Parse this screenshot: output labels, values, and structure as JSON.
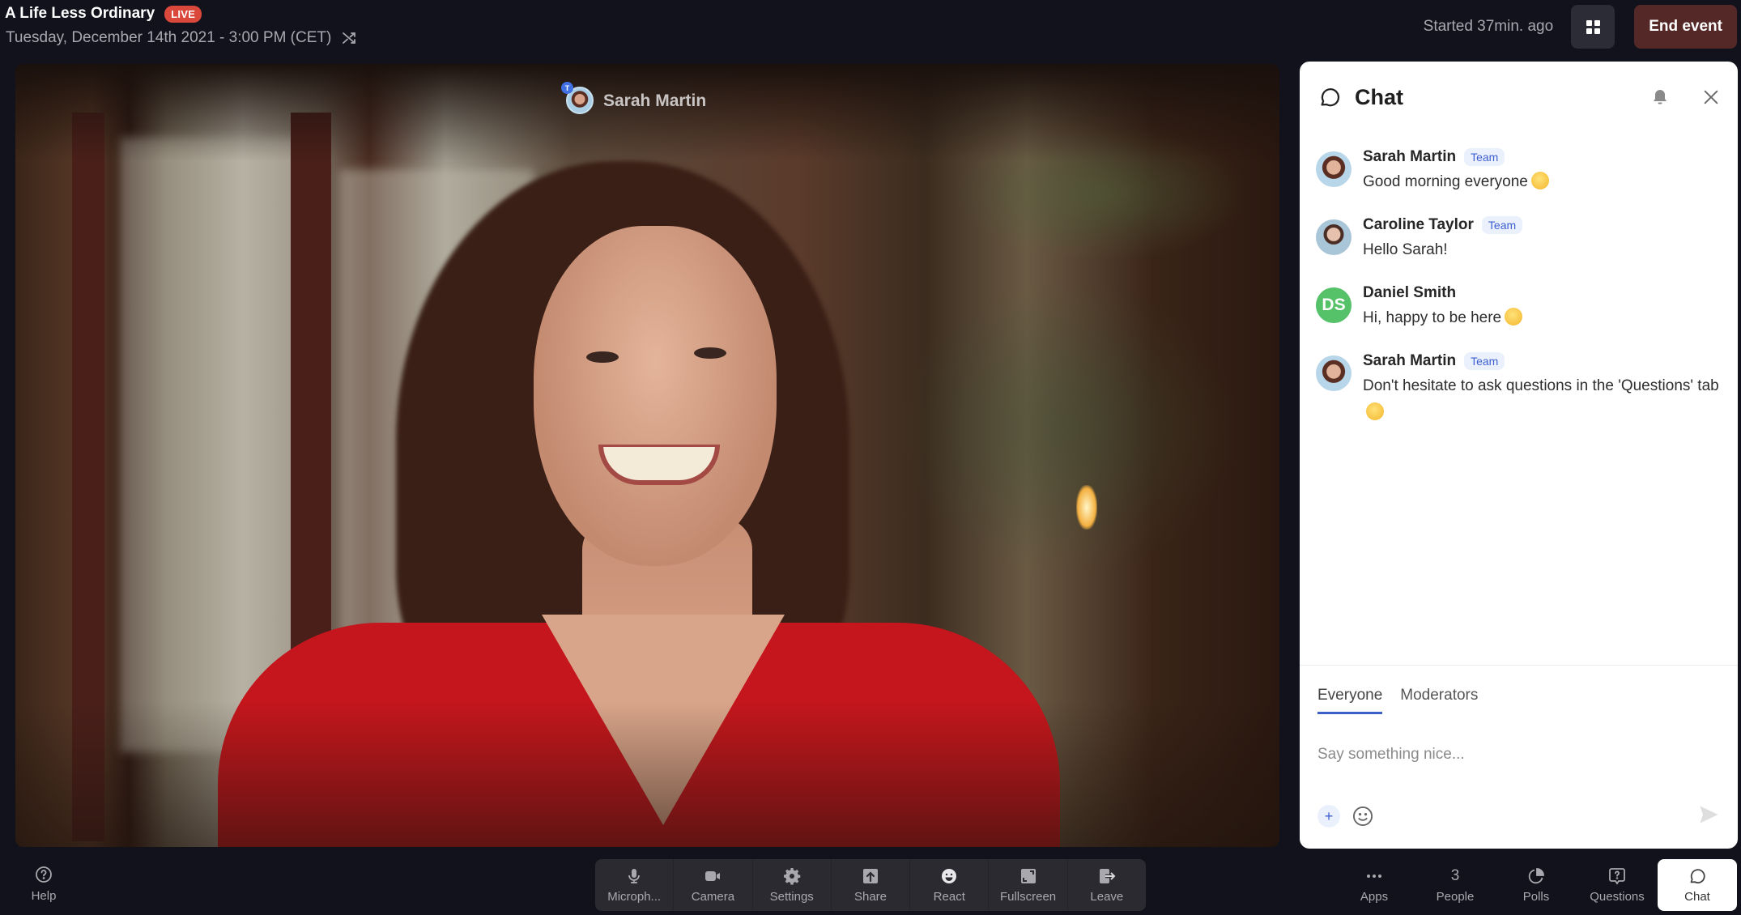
{
  "header": {
    "title": "A Life Less Ordinary",
    "live_badge": "LIVE",
    "date": "Tuesday, December 14th 2021 - 3:00 PM (CET)",
    "started": "Started 37min. ago",
    "end_event_label": "End event"
  },
  "video": {
    "speaker_name": "Sarah Martin",
    "speaker_badge": "T"
  },
  "chat": {
    "title": "Chat",
    "messages": [
      {
        "name": "Sarah Martin",
        "badge": "Team",
        "text": "Good morning everyone",
        "emoji": "slightly-smiling-face"
      },
      {
        "name": "Caroline Taylor",
        "badge": "Team",
        "text": "Hello Sarah!"
      },
      {
        "name": "Daniel Smith",
        "initials": "DS",
        "text": "Hi, happy to be here",
        "emoji": "grinning-face"
      },
      {
        "name": "Sarah Martin",
        "badge": "Team",
        "text": "Don't hesitate to ask questions in the 'Questions' tab",
        "emoji": "winking-face"
      }
    ],
    "tabs": [
      {
        "label": "Everyone",
        "active": true
      },
      {
        "label": "Moderators",
        "active": false
      }
    ],
    "input_placeholder": "Say something nice...",
    "add_label": "+",
    "colors": {
      "accent": "#3d5fc8",
      "team_badge_bg": "#eaf1fd",
      "initials_avatar": "#55c168"
    }
  },
  "bottom_bar": {
    "help_label": "Help",
    "controls": [
      {
        "label": "Microph...",
        "icon": "microphone-icon"
      },
      {
        "label": "Camera",
        "icon": "camera-icon"
      },
      {
        "label": "Settings",
        "icon": "gear-icon"
      },
      {
        "label": "Share",
        "icon": "share-icon"
      },
      {
        "label": "React",
        "icon": "smiley-icon"
      },
      {
        "label": "Fullscreen",
        "icon": "fullscreen-icon"
      },
      {
        "label": "Leave",
        "icon": "leave-icon"
      }
    ],
    "nav": [
      {
        "label": "Apps",
        "icon": "more-dots-icon"
      },
      {
        "label": "People",
        "count": "3"
      },
      {
        "label": "Polls",
        "icon": "pie-chart-icon"
      },
      {
        "label": "Questions",
        "icon": "question-box-icon"
      },
      {
        "label": "Chat",
        "icon": "chat-bubble-icon",
        "active": true
      }
    ]
  },
  "colors": {
    "background": "#12121c",
    "live": "#d9483b",
    "end_event": "#532827"
  }
}
